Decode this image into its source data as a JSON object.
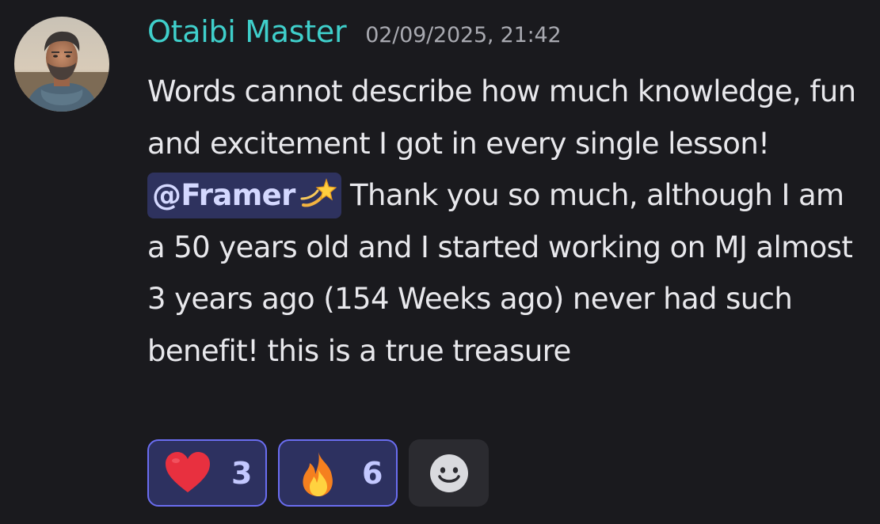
{
  "message": {
    "author": "Otaibi Master",
    "timestamp": "02/09/2025, 21:42",
    "text_part1": "Words cannot describe how much knowledge, fun and excitement I got in every single lesson! ",
    "mention": "@Framer",
    "mention_emoji_icon": "dizzy-star-icon",
    "text_part2": " Thank you so much, although I am a 50 years old and I started working on MJ almost 3 years ago (154 Weeks ago) never had such benefit! this is a true treasure"
  },
  "reactions": [
    {
      "icon": "red-heart-icon",
      "count": "3"
    },
    {
      "icon": "fire-icon",
      "count": "6"
    }
  ],
  "add_reaction_icon": "smiley-face-icon",
  "colors": {
    "background": "#1a1a1e",
    "username": "#3fcfcb",
    "timestamp": "#a8a9b0",
    "mention_bg": "#2e325e",
    "reaction_border": "#6a6df0",
    "reaction_bg": "#2d3160"
  }
}
